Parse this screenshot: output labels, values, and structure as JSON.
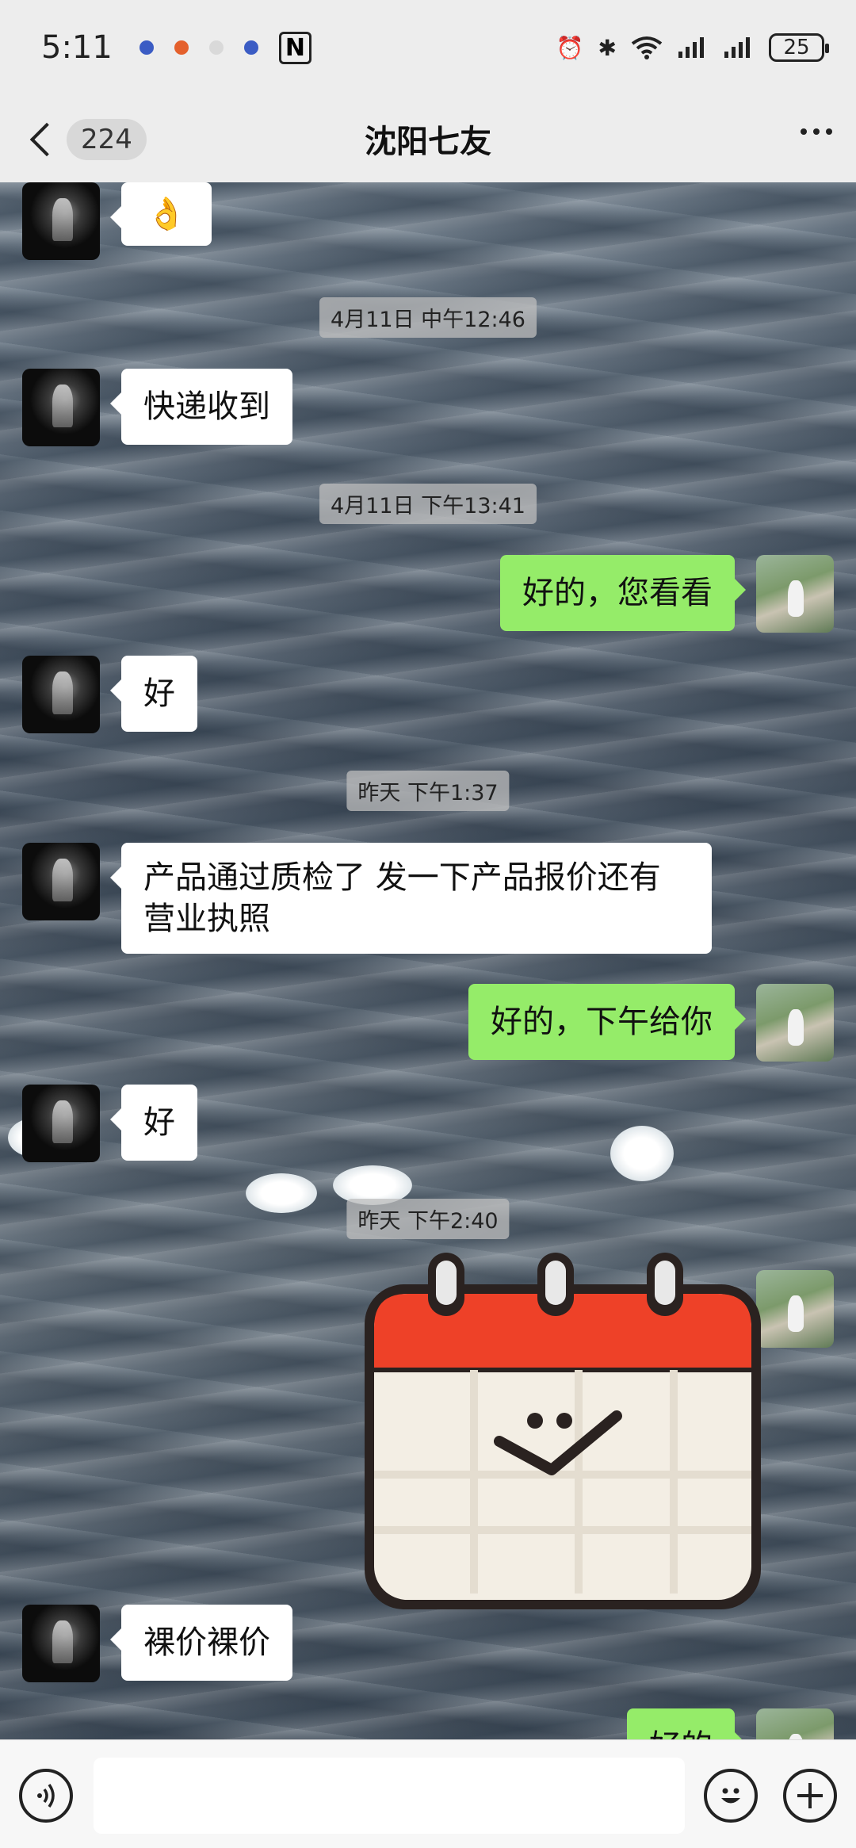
{
  "status_bar": {
    "time": "5:11",
    "battery": "25"
  },
  "nav": {
    "unread_count": "224",
    "title": "沈阳七友"
  },
  "messages": [
    {
      "side": "left",
      "text": "👌"
    },
    {
      "side": "time",
      "text": "4月11日 中午12:46"
    },
    {
      "side": "left",
      "text": "快递收到"
    },
    {
      "side": "time",
      "text": "4月11日 下午13:41"
    },
    {
      "side": "right",
      "text": "好的，您看看"
    },
    {
      "side": "left",
      "text": "好"
    },
    {
      "side": "time",
      "text": "昨天 下午1:37"
    },
    {
      "side": "left",
      "text": "产品通过质检了 发一下产品报价还有营业执照"
    },
    {
      "side": "right",
      "text": "好的，下午给你"
    },
    {
      "side": "left",
      "text": "好"
    },
    {
      "side": "time",
      "text": "昨天 下午2:40"
    },
    {
      "side": "right",
      "type": "sticker",
      "sticker": "calendar-smile"
    },
    {
      "side": "left",
      "text": "裸价裸价"
    },
    {
      "side": "right",
      "text": "好的"
    }
  ],
  "input_bar": {
    "voice_icon": "voice-icon",
    "emoji_icon": "emoji-icon",
    "plus_icon": "plus-icon"
  },
  "colors": {
    "outgoing_bubble": "#95ec69",
    "incoming_bubble": "#ffffff",
    "bar_bg": "#ededed"
  }
}
